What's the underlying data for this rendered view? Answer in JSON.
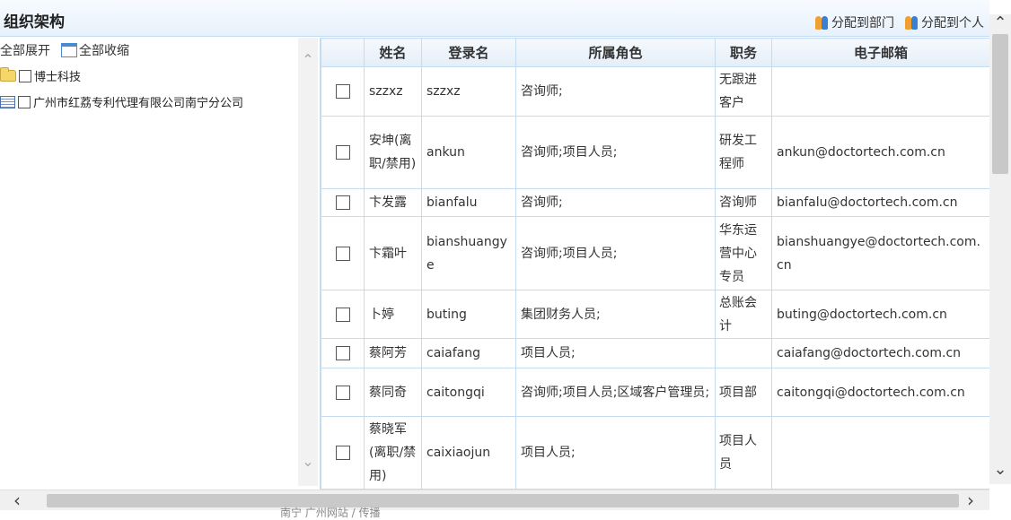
{
  "panel": {
    "title": "组织架构",
    "assign_dept": "分配到部门",
    "assign_person": "分配到个人"
  },
  "tree": {
    "expand_all": "全部展开",
    "collapse_all": "全部收缩",
    "nodes": [
      {
        "label": "博士科技",
        "icon": "folder-icon"
      },
      {
        "label": "广州市红荔专利代理有限公司南宁分公司",
        "icon": "org-icon"
      }
    ]
  },
  "grid": {
    "columns": [
      "",
      "姓名",
      "登录名",
      "所属角色",
      "职务",
      "电子邮箱"
    ],
    "rows": [
      {
        "name": "szzxz",
        "login": "szzxz",
        "role": "咨询师;",
        "job": "无跟进客户",
        "email": ""
      },
      {
        "name": "安坤(离职/禁用)",
        "login": "ankun",
        "role": "咨询师;项目人员;",
        "job": "研发工程师",
        "email": "ankun@doctortech.com.cn"
      },
      {
        "name": "卞发露",
        "login": "bianfalu",
        "role": "咨询师;",
        "job": "咨询师",
        "email": "bianfalu@doctortech.com.cn"
      },
      {
        "name": "卞霜叶",
        "login": "bianshuangye",
        "role": "咨询师;项目人员;",
        "job": "华东运营中心专员",
        "email": "bianshuangye@doctortech.com.cn"
      },
      {
        "name": "卜婷",
        "login": "buting",
        "role": "集团财务人员;",
        "job": "总账会计",
        "email": "buting@doctortech.com.cn"
      },
      {
        "name": "蔡阿芳",
        "login": "caiafang",
        "role": "项目人员;",
        "job": "",
        "email": "caiafang@doctortech.com.cn"
      },
      {
        "name": "蔡同奇",
        "login": "caitongqi",
        "role": "咨询师;项目人员;区域客户管理员;",
        "job": "项目部",
        "email": "caitongqi@doctortech.com.cn"
      },
      {
        "name": "蔡晓军(离职/禁用)",
        "login": "caixiaojun",
        "role": "项目人员;",
        "job": "项目人员",
        "email": ""
      }
    ]
  },
  "footer_partial_text": "南宁 广州网站 / 传播"
}
